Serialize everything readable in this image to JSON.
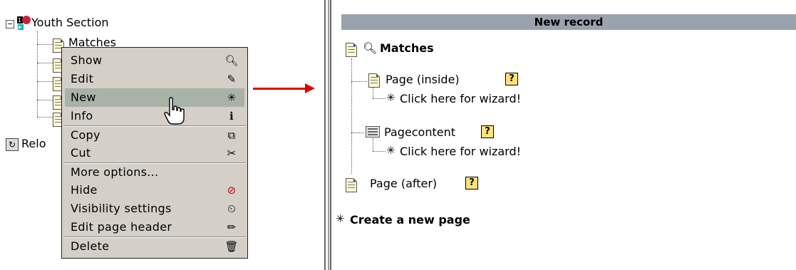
{
  "tree": {
    "root_label": "Youth Section",
    "child_label": "Matches",
    "reload_label": "Relo"
  },
  "context_menu": {
    "items": [
      {
        "label": "Show",
        "icon": "magnifier-icon"
      },
      {
        "label": "Edit",
        "icon": "edit-icon"
      },
      {
        "label": "New",
        "icon": "new-record-icon"
      },
      {
        "label": "Info",
        "icon": "info-icon"
      },
      {
        "label": "Copy",
        "icon": "copy-icon"
      },
      {
        "label": "Cut",
        "icon": "scissors-icon"
      },
      {
        "label": "More options...",
        "icon": ""
      },
      {
        "label": "Hide",
        "icon": "hide-icon"
      },
      {
        "label": "Visibility settings",
        "icon": "visibility-icon"
      },
      {
        "label": "Edit page header",
        "icon": "pencil-icon"
      },
      {
        "label": "Delete",
        "icon": "trash-icon"
      }
    ],
    "highlighted_item": "New"
  },
  "new_record": {
    "header": "New record",
    "parent_label": "Matches",
    "page_inside_label": "Page (inside)",
    "wizard_label_1": "Click here for wizard!",
    "pagecontent_label": "Pagecontent",
    "wizard_label_2": "Click here for wizard!",
    "page_after_label": "Page (after)",
    "help_glyph": "?",
    "create_page_label": "Create a new page"
  },
  "colors": {
    "menu_bg": "#d4d0c8",
    "menu_highlight": "#a8b2a8",
    "header_bg": "#9aa3ad",
    "arrow": "#e00000"
  }
}
